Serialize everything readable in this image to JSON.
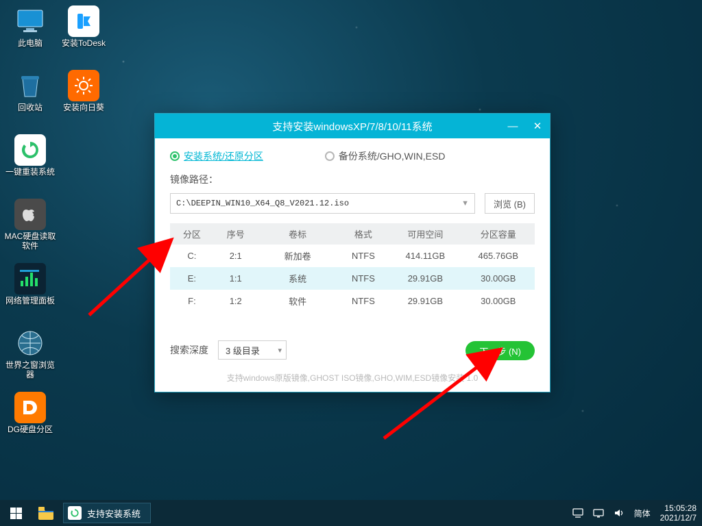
{
  "desktop": {
    "col_left": [
      {
        "name": "此电脑"
      },
      {
        "name": "回收站"
      },
      {
        "name": "一键重装系统"
      },
      {
        "name": "MAC硬盘读取软件"
      },
      {
        "name": "网络管理面板"
      },
      {
        "name": "世界之窗浏览器"
      },
      {
        "name": "DG硬盘分区"
      }
    ],
    "col_right": [
      {
        "name": "安装ToDesk"
      },
      {
        "name": "安装向日葵"
      }
    ]
  },
  "window": {
    "title": "支持安装windowsXP/7/8/10/11系统",
    "radio_install": "安装系统/还原分区",
    "radio_backup": "备份系统/GHO,WIN,ESD",
    "path_label": "镜像路径：",
    "path_value": "C:\\DEEPIN_WIN10_X64_Q8_V2021.12.iso",
    "browse": "浏览 (B)",
    "columns": [
      "分区",
      "序号",
      "卷标",
      "格式",
      "可用空间",
      "分区容量"
    ],
    "rows": [
      {
        "p": "C:",
        "n": "2:1",
        "v": "新加卷",
        "f": "NTFS",
        "free": "414.11GB",
        "cap": "465.76GB",
        "selected": false
      },
      {
        "p": "E:",
        "n": "1:1",
        "v": "系统",
        "f": "NTFS",
        "free": "29.91GB",
        "cap": "30.00GB",
        "selected": true
      },
      {
        "p": "F:",
        "n": "1:2",
        "v": "软件",
        "f": "NTFS",
        "free": "29.91GB",
        "cap": "30.00GB",
        "selected": false
      }
    ],
    "search_label": "搜索深度",
    "search_value": "3 级目录",
    "next": "下一步 (N)",
    "support_note": "支持windows原版镜像,GHOST ISO镜像,GHO,WIM,ESD镜像安装    1.0"
  },
  "taskbar": {
    "app_label": "支持安装系统",
    "ime": "简体",
    "time": "15:05:28",
    "date": "2021/12/7"
  }
}
